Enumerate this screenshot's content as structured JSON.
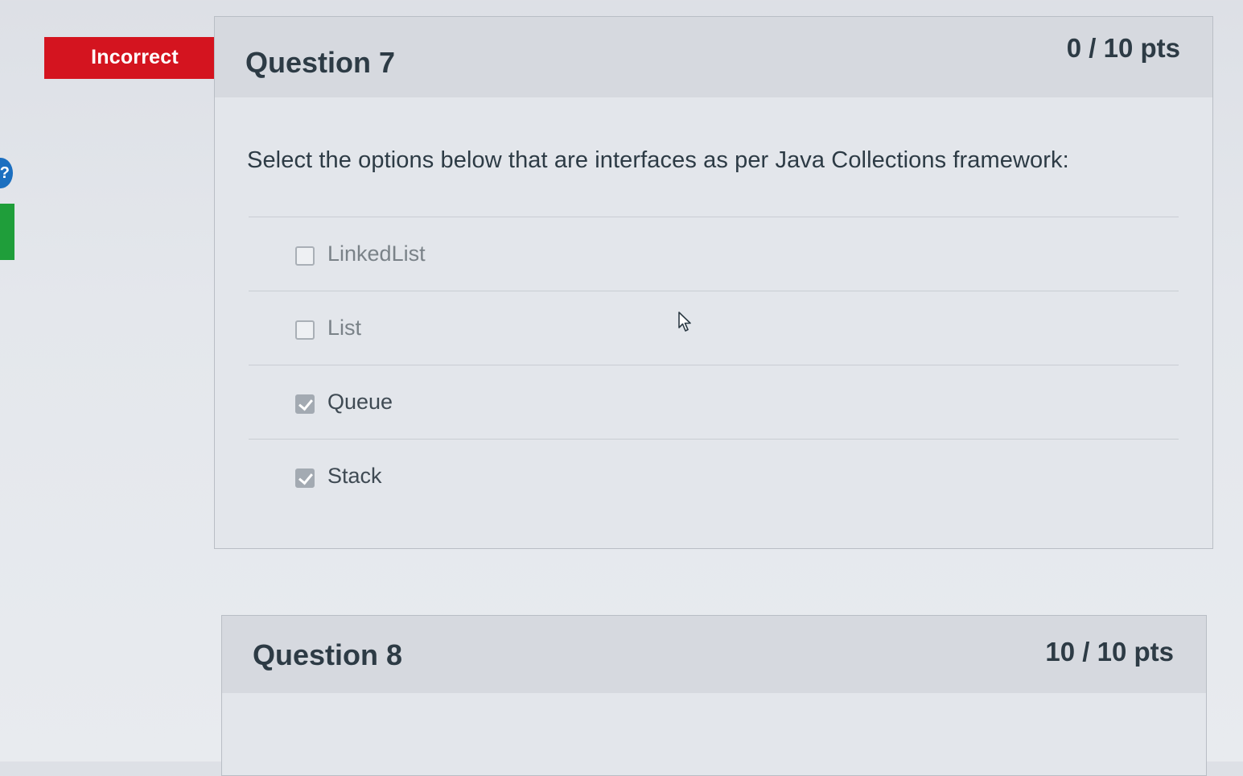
{
  "status_flag": {
    "label": "Incorrect",
    "color": "#d4141f"
  },
  "left_rail": {
    "help_icon": "question-mark-icon",
    "help_glyph": "?",
    "accent_color": "#1f9e3a"
  },
  "questions": [
    {
      "title": "Question 7",
      "points": "0 / 10 pts",
      "prompt": "Select the options below that are interfaces as per Java Collections framework:",
      "answers": [
        {
          "label": "LinkedList",
          "checked": false
        },
        {
          "label": "List",
          "checked": false
        },
        {
          "label": "Queue",
          "checked": true
        },
        {
          "label": "Stack",
          "checked": true
        }
      ]
    },
    {
      "title": "Question 8",
      "points": "10 / 10 pts"
    }
  ]
}
